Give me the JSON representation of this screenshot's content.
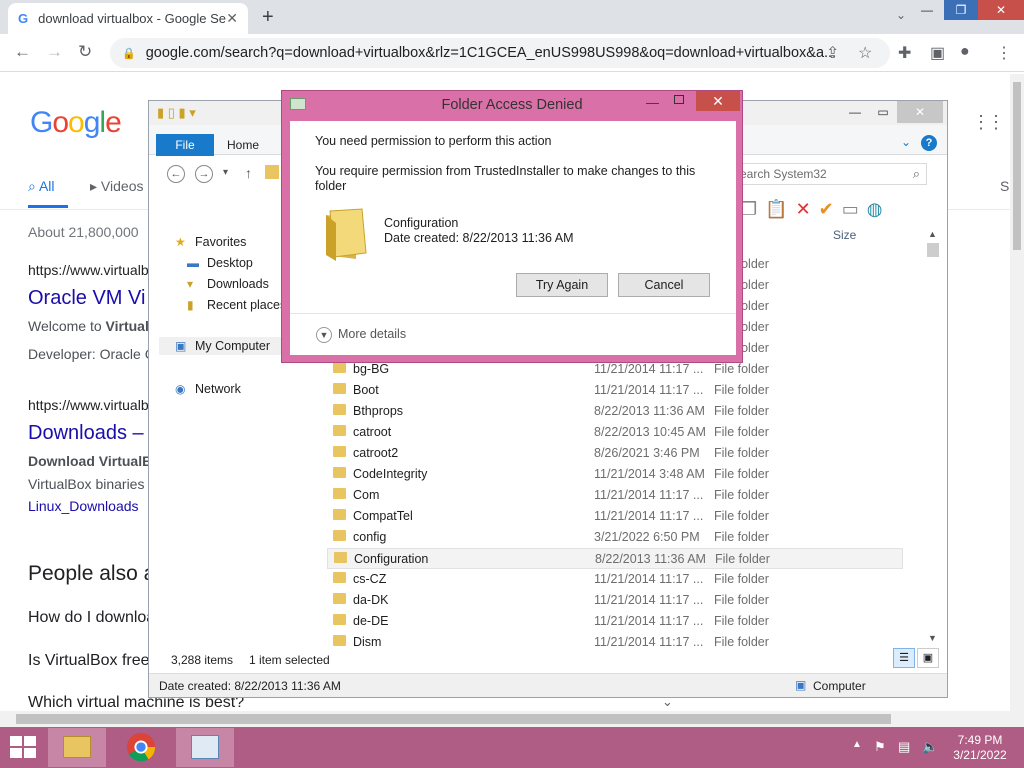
{
  "browser": {
    "tab_title": "download virtualbox - Google Se",
    "url": "google.com/search?q=download+virtualbox&rlz=1C1GCEA_enUS998US998&oq=download+virtualbox&a..."
  },
  "google": {
    "logo": "Google",
    "tab_all": "All",
    "tab_videos": "Videos",
    "tab_s": "S",
    "results_count": "About 21,800,000",
    "r1_url": "https://www.virtualbo",
    "r1_title": "Oracle VM Vi",
    "r1_line1_a": "Welcome to ",
    "r1_line1_b": "Virtual",
    "r1_line2": "Developer: Oracle C",
    "r2_url": "https://www.virtualbo",
    "r2_title": "Downloads –",
    "r2_line1": "Download VirtualBo",
    "r2_line2": "VirtualBox binaries",
    "r2_link": "Linux_Downloads",
    "paa_title": "People also a",
    "paa_q1": "How do I downloa",
    "paa_q2": "Is VirtualBox free",
    "paa_q3": "Which virtual machine is best?"
  },
  "explorer": {
    "ribbon_file": "File",
    "ribbon_home": "Home",
    "search_placeholder": "earch System32",
    "col_size": "Size",
    "nav": {
      "favorites": "Favorites",
      "desktop": "Desktop",
      "downloads": "Downloads",
      "recent": "Recent places",
      "my_computer": "My Computer",
      "network": "Network"
    },
    "hidden_rows": [
      {
        "type": "File folder"
      },
      {
        "type": "File folder"
      },
      {
        "type": "File folder"
      },
      {
        "type": "File folder"
      },
      {
        "type": "File folder"
      }
    ],
    "rows": [
      {
        "name": "bg-BG",
        "date": "11/21/2014 11:17 ...",
        "type": "File folder"
      },
      {
        "name": "Boot",
        "date": "11/21/2014 11:17 ...",
        "type": "File folder"
      },
      {
        "name": "Bthprops",
        "date": "8/22/2013 11:36 AM",
        "type": "File folder"
      },
      {
        "name": "catroot",
        "date": "8/22/2013 10:45 AM",
        "type": "File folder"
      },
      {
        "name": "catroot2",
        "date": "8/26/2021 3:46 PM",
        "type": "File folder"
      },
      {
        "name": "CodeIntegrity",
        "date": "11/21/2014 3:48 AM",
        "type": "File folder"
      },
      {
        "name": "Com",
        "date": "11/21/2014 11:17 ...",
        "type": "File folder"
      },
      {
        "name": "CompatTel",
        "date": "11/21/2014 11:17 ...",
        "type": "File folder"
      },
      {
        "name": "config",
        "date": "3/21/2022 6:50 PM",
        "type": "File folder"
      },
      {
        "name": "Configuration",
        "date": "8/22/2013 11:36 AM",
        "type": "File folder"
      },
      {
        "name": "cs-CZ",
        "date": "11/21/2014 11:17 ...",
        "type": "File folder"
      },
      {
        "name": "da-DK",
        "date": "11/21/2014 11:17 ...",
        "type": "File folder"
      },
      {
        "name": "de-DE",
        "date": "11/21/2014 11:17 ...",
        "type": "File folder"
      },
      {
        "name": "Dism",
        "date": "11/21/2014 11:17 ...",
        "type": "File folder"
      }
    ],
    "item_count": "3,288 items",
    "selected": "1 item selected",
    "details_date": "Date created: 8/22/2013 11:36 AM",
    "details_location": "Computer"
  },
  "dialog": {
    "title": "Folder Access Denied",
    "message1": "You need permission to perform this action",
    "message2": "You require permission from TrustedInstaller to make changes to this folder",
    "folder_name": "Configuration",
    "folder_date": "Date created: 8/22/2013 11:36 AM",
    "try_again": "Try Again",
    "cancel": "Cancel",
    "more_details": "More details"
  },
  "taskbar": {
    "time": "7:49 PM",
    "date": "3/21/2022"
  },
  "colors": {
    "dialog_border": "#d971a8",
    "taskbar": "#b05d85",
    "google_link": "#1a0dab",
    "file_tab": "#1979ca"
  }
}
